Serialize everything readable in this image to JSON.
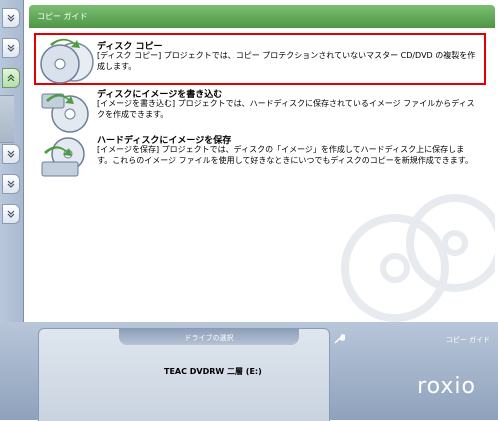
{
  "sidebar": {
    "buttons": [
      {
        "name": "collapse-chevron-1",
        "icon": "chevron-down-icon"
      },
      {
        "name": "collapse-chevron-2",
        "icon": "chevron-down-icon"
      },
      {
        "name": "expand-chevron-active",
        "icon": "chevron-up-icon"
      },
      {
        "name": "collapse-chevron-3",
        "icon": "chevron-down-icon"
      },
      {
        "name": "collapse-chevron-4",
        "icon": "chevron-down-icon"
      },
      {
        "name": "collapse-chevron-5",
        "icon": "chevron-down-icon"
      }
    ]
  },
  "panel": {
    "header": "コピー ガイド",
    "items": [
      {
        "title": "ディスク コピー",
        "description": "[ディスク コピー] プロジェクトでは、コピー プロテクションされていないマスター CD/DVD の複製を作成します。",
        "selected": true
      },
      {
        "title": "ディスクにイメージを書き込む",
        "description": "[イメージを書き込む] プロジェクトでは、ハードディスクに保存されているイメージ ファイルからディスクを作成できます。",
        "selected": false
      },
      {
        "title": "ハードディスクにイメージを保存",
        "description": "[イメージを保存] プロジェクトでは、ディスクの「イメージ」を作成してハードディスク上に保存します。これらのイメージ ファイルを使用して好きなときにいつでもディスクのコピーを新規作成できます。",
        "selected": false
      }
    ]
  },
  "bottom": {
    "drive_select_label": "ドライブの選択",
    "drive_name": "TEAC DVDRW 二層 (E:)",
    "guide_label": "コピー ガイド",
    "brand": "roxio"
  },
  "colors": {
    "header_green": "#5ea855",
    "selection_red": "#e00000",
    "bottom_blue": "#a3b4cb"
  }
}
